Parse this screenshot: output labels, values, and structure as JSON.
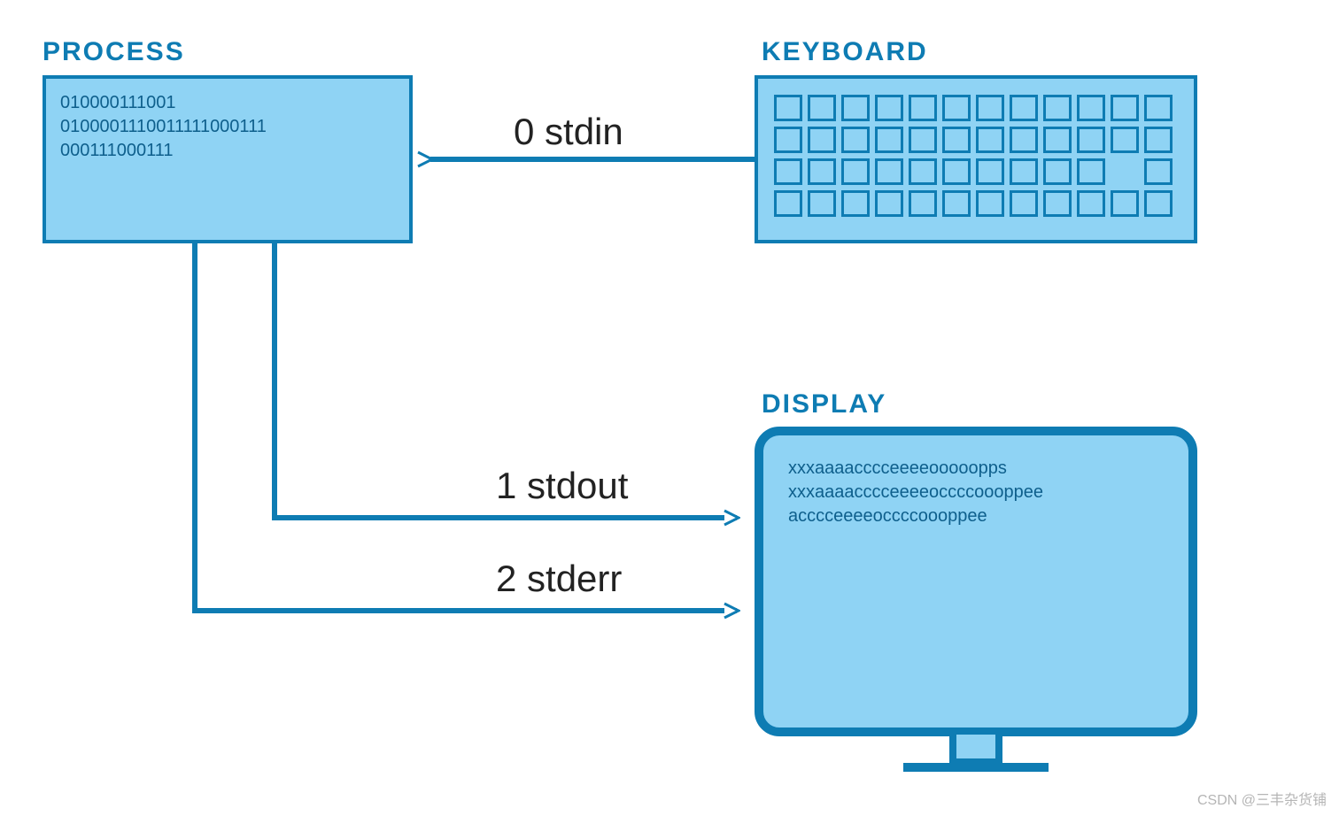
{
  "labels": {
    "process": "PROCESS",
    "keyboard": "KEYBOARD",
    "display": "DISPLAY"
  },
  "process": {
    "line1": "010000111001",
    "line2": "0100001110011111000111",
    "line3": "000111000111"
  },
  "display": {
    "line1": "xxxaaaacccceeeeooooopps",
    "line2": "xxxaaaacccceeeeoccccoooppee",
    "line3": "acccceeeeoccccoooppee"
  },
  "arrows": {
    "stdin": "0 stdin",
    "stdout": "1 stdout",
    "stderr": "2 stderr"
  },
  "keyboard_rows": [
    [
      1,
      1,
      1,
      1,
      1,
      1,
      1,
      1,
      1,
      1,
      1,
      1
    ],
    [
      1,
      1,
      1,
      1,
      1,
      1,
      1,
      1,
      1,
      1,
      1,
      1
    ],
    [
      1,
      1,
      1,
      1,
      1,
      1,
      1,
      1,
      1,
      1,
      0,
      1
    ],
    [
      1,
      1,
      1,
      1,
      1,
      1,
      1,
      1,
      1,
      1,
      1,
      1
    ]
  ],
  "watermark": "CSDN @三丰杂货铺",
  "colors": {
    "fill": "#8FD3F4",
    "stroke": "#0E7CB3",
    "text": "#0E5F8C"
  }
}
